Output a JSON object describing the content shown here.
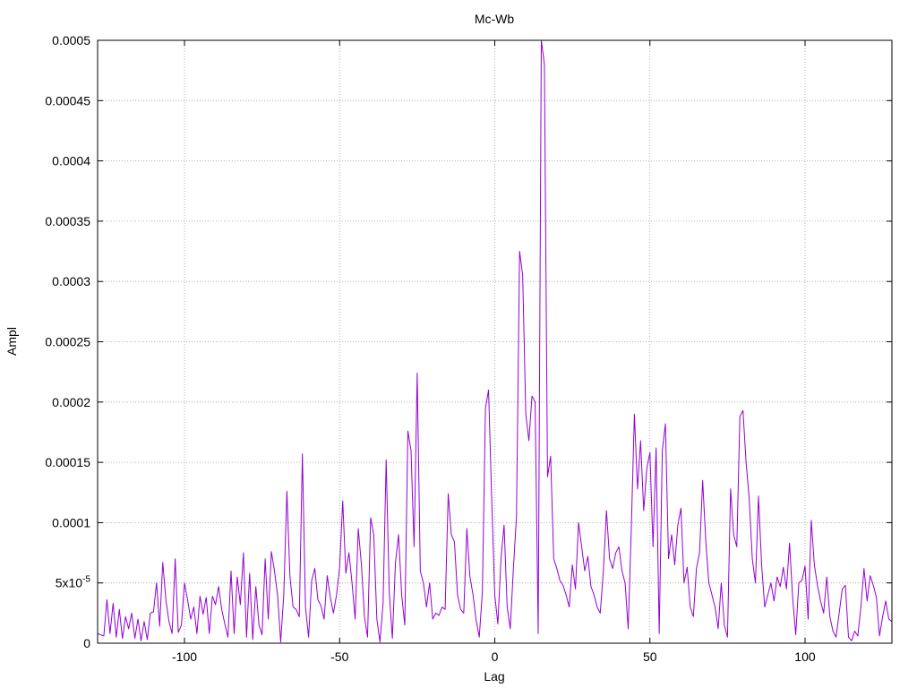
{
  "chart_data": {
    "type": "line",
    "title": "Mc-Wb",
    "xlabel": "Lag",
    "ylabel": "Ampl",
    "xlim": [
      -128,
      128
    ],
    "ylim": [
      0,
      0.0005
    ],
    "grid": true,
    "x_ticks": [
      {
        "value": -100,
        "label": "-100"
      },
      {
        "value": -50,
        "label": "-50"
      },
      {
        "value": 0,
        "label": "0"
      },
      {
        "value": 50,
        "label": "50"
      },
      {
        "value": 100,
        "label": "100"
      }
    ],
    "y_ticks": [
      {
        "value": 0,
        "label": "0"
      },
      {
        "value": 5e-05,
        "label": "5x10",
        "sup": "-5"
      },
      {
        "value": 0.0001,
        "label": "0.0001"
      },
      {
        "value": 0.00015,
        "label": "0.00015"
      },
      {
        "value": 0.0002,
        "label": "0.0002"
      },
      {
        "value": 0.00025,
        "label": "0.00025"
      },
      {
        "value": 0.0003,
        "label": "0.0003"
      },
      {
        "value": 0.00035,
        "label": "0.00035"
      },
      {
        "value": 0.0004,
        "label": "0.0004"
      },
      {
        "value": 0.00045,
        "label": "0.00045"
      },
      {
        "value": 0.0005,
        "label": "0.0005"
      }
    ],
    "series": [
      {
        "color": "#9400d3",
        "points": [
          [
            -128,
            8e-06
          ],
          [
            -126,
            6e-06
          ],
          [
            -125,
            3.6e-05
          ],
          [
            -124,
            8e-06
          ],
          [
            -123,
            3.3e-05
          ],
          [
            -122,
            5e-06
          ],
          [
            -121,
            2.8e-05
          ],
          [
            -120,
            4e-06
          ],
          [
            -119,
            2.2e-05
          ],
          [
            -118,
            1.2e-05
          ],
          [
            -117,
            2.5e-05
          ],
          [
            -116,
            4e-06
          ],
          [
            -115,
            2e-05
          ],
          [
            -114,
            2e-06
          ],
          [
            -113,
            1.8e-05
          ],
          [
            -112,
            3e-06
          ],
          [
            -111,
            2.5e-05
          ],
          [
            -110,
            2.6e-05
          ],
          [
            -109,
            5e-05
          ],
          [
            -108,
            1.4e-05
          ],
          [
            -107,
            6.7e-05
          ],
          [
            -106,
            3.6e-05
          ],
          [
            -105,
            1.8e-05
          ],
          [
            -104,
            8e-06
          ],
          [
            -103,
            7e-05
          ],
          [
            -102,
            9e-06
          ],
          [
            -101,
            1.5e-05
          ],
          [
            -100,
            5e-05
          ],
          [
            -99,
            3.6e-05
          ],
          [
            -98,
            2e-05
          ],
          [
            -97,
            3e-05
          ],
          [
            -96,
            8e-06
          ],
          [
            -95,
            3.9e-05
          ],
          [
            -94,
            2.4e-05
          ],
          [
            -93,
            3.8e-05
          ],
          [
            -92,
            8e-06
          ],
          [
            -91,
            3.9e-05
          ],
          [
            -90,
            3.2e-05
          ],
          [
            -89,
            4.7e-05
          ],
          [
            -88,
            2.8e-05
          ],
          [
            -87,
            1.6e-05
          ],
          [
            -86,
            5e-06
          ],
          [
            -85,
            6e-05
          ],
          [
            -84,
            8e-06
          ],
          [
            -83,
            5.5e-05
          ],
          [
            -82,
            3.2e-05
          ],
          [
            -81,
            7.5e-05
          ],
          [
            -80,
            5e-06
          ],
          [
            -79,
            5.8e-05
          ],
          [
            -78,
            3e-06
          ],
          [
            -77,
            4.7e-05
          ],
          [
            -76,
            1.5e-05
          ],
          [
            -75,
            7e-06
          ],
          [
            -74,
            7e-05
          ],
          [
            -73,
            2e-05
          ],
          [
            -72,
            7.6e-05
          ],
          [
            -71,
            6e-05
          ],
          [
            -70,
            4e-05
          ],
          [
            -69,
            1e-06
          ],
          [
            -68,
            4e-05
          ],
          [
            -67,
            0.000126
          ],
          [
            -66,
            5.5e-05
          ],
          [
            -65,
            3e-05
          ],
          [
            -64,
            2.8e-05
          ],
          [
            -63,
            2.2e-05
          ],
          [
            -62,
            0.000157
          ],
          [
            -61,
            3e-05
          ],
          [
            -60,
            5e-06
          ],
          [
            -59,
            5.2e-05
          ],
          [
            -58,
            6.2e-05
          ],
          [
            -57,
            3.6e-05
          ],
          [
            -56,
            3.1e-05
          ],
          [
            -55,
            2e-05
          ],
          [
            -54,
            5.6e-05
          ],
          [
            -53,
            3.8e-05
          ],
          [
            -52,
            2.5e-05
          ],
          [
            -51,
            4e-05
          ],
          [
            -50,
            6.3e-05
          ],
          [
            -49,
            0.000118
          ],
          [
            -48,
            5.8e-05
          ],
          [
            -47,
            7.5e-05
          ],
          [
            -46,
            5e-05
          ],
          [
            -45,
            2e-05
          ],
          [
            -44,
            9.5e-05
          ],
          [
            -43,
            6.6e-05
          ],
          [
            -42,
            2.2e-05
          ],
          [
            -41,
            5e-06
          ],
          [
            -40,
            0.000104
          ],
          [
            -39,
            9e-05
          ],
          [
            -38,
            2e-05
          ],
          [
            -37,
            1e-06
          ],
          [
            -36,
            3.3e-05
          ],
          [
            -35,
            0.000152
          ],
          [
            -34,
            4.2e-05
          ],
          [
            -33,
            4e-06
          ],
          [
            -32,
            6.7e-05
          ],
          [
            -31,
            9e-05
          ],
          [
            -30,
            4e-05
          ],
          [
            -29,
            1.5e-05
          ],
          [
            -28,
            0.000176
          ],
          [
            -27,
            0.00016
          ],
          [
            -26,
            8e-05
          ],
          [
            -25,
            0.000224
          ],
          [
            -24,
            6e-05
          ],
          [
            -23,
            5e-05
          ],
          [
            -22,
            3e-05
          ],
          [
            -21,
            5e-05
          ],
          [
            -20,
            2e-05
          ],
          [
            -19,
            2.5e-05
          ],
          [
            -18,
            2.3e-05
          ],
          [
            -17,
            3e-05
          ],
          [
            -16,
            2.8e-05
          ],
          [
            -15,
            0.000124
          ],
          [
            -14,
            9e-05
          ],
          [
            -13,
            8.4e-05
          ],
          [
            -12,
            4e-05
          ],
          [
            -11,
            2.8e-05
          ],
          [
            -10,
            2.5e-05
          ],
          [
            -9,
            9.5e-05
          ],
          [
            -8,
            5.5e-05
          ],
          [
            -7,
            4e-05
          ],
          [
            -6,
            1.9e-05
          ],
          [
            -5,
            5e-06
          ],
          [
            -4,
            4.2e-05
          ],
          [
            -3,
            0.000195
          ],
          [
            -2,
            0.00021
          ],
          [
            -1,
            0.00012
          ],
          [
            0,
            4e-05
          ],
          [
            1,
            1.6e-05
          ],
          [
            2,
            7e-05
          ],
          [
            3,
            9.8e-05
          ],
          [
            4,
            3e-05
          ],
          [
            5,
            1.2e-05
          ],
          [
            6,
            6.2e-05
          ],
          [
            7,
            0.000105
          ],
          [
            8,
            0.000325
          ],
          [
            9,
            0.000305
          ],
          [
            10,
            0.00019
          ],
          [
            11,
            0.000168
          ],
          [
            12,
            0.000205
          ],
          [
            13,
            0.0002
          ],
          [
            14,
            8e-06
          ],
          [
            15,
            0.0005
          ],
          [
            16,
            0.00048
          ],
          [
            17,
            0.000138
          ],
          [
            18,
            0.000155
          ],
          [
            19,
            7e-05
          ],
          [
            20,
            6.2e-05
          ],
          [
            21,
            5.2e-05
          ],
          [
            22,
            4.8e-05
          ],
          [
            23,
            4e-05
          ],
          [
            24,
            3e-05
          ],
          [
            25,
            6.5e-05
          ],
          [
            26,
            4.5e-05
          ],
          [
            27,
            0.0001
          ],
          [
            28,
            8e-05
          ],
          [
            29,
            6e-05
          ],
          [
            30,
            7.2e-05
          ],
          [
            31,
            4.7e-05
          ],
          [
            32,
            4e-05
          ],
          [
            33,
            3e-05
          ],
          [
            34,
            2.5e-05
          ],
          [
            35,
            6e-05
          ],
          [
            36,
            0.00011
          ],
          [
            37,
            7e-05
          ],
          [
            38,
            6.2e-05
          ],
          [
            39,
            7.5e-05
          ],
          [
            40,
            8e-05
          ],
          [
            41,
            6e-05
          ],
          [
            42,
            5e-05
          ],
          [
            43,
            1.2e-05
          ],
          [
            44,
            9.5e-05
          ],
          [
            45,
            0.00019
          ],
          [
            46,
            0.000128
          ],
          [
            47,
            0.000168
          ],
          [
            48,
            0.00011
          ],
          [
            49,
            0.000145
          ],
          [
            50,
            0.000158
          ],
          [
            51,
            8e-05
          ],
          [
            52,
            0.000162
          ],
          [
            53,
            8e-06
          ],
          [
            54,
            0.00016
          ],
          [
            55,
            0.000182
          ],
          [
            56,
            7e-05
          ],
          [
            57,
            9e-05
          ],
          [
            58,
            6.5e-05
          ],
          [
            59,
            9.8e-05
          ],
          [
            60,
            0.000112
          ],
          [
            61,
            5e-05
          ],
          [
            62,
            6.3e-05
          ],
          [
            63,
            3e-05
          ],
          [
            64,
            2.2e-05
          ],
          [
            65,
            6.2e-05
          ],
          [
            66,
            7.5e-05
          ],
          [
            67,
            0.000135
          ],
          [
            68,
            8.5e-05
          ],
          [
            69,
            5e-05
          ],
          [
            70,
            4e-05
          ],
          [
            71,
            3e-05
          ],
          [
            72,
            1.2e-05
          ],
          [
            73,
            5e-05
          ],
          [
            74,
            1.5e-05
          ],
          [
            75,
            5e-06
          ],
          [
            76,
            0.000128
          ],
          [
            77,
            9e-05
          ],
          [
            78,
            8e-05
          ],
          [
            79,
            0.000188
          ],
          [
            80,
            0.000193
          ],
          [
            81,
            0.00015
          ],
          [
            82,
            0.00012
          ],
          [
            83,
            7e-05
          ],
          [
            84,
            5e-05
          ],
          [
            85,
            0.000122
          ],
          [
            86,
            6.5e-05
          ],
          [
            87,
            3e-05
          ],
          [
            88,
            4e-05
          ],
          [
            89,
            5e-05
          ],
          [
            90,
            3.5e-05
          ],
          [
            91,
            5.5e-05
          ],
          [
            92,
            4.7e-05
          ],
          [
            93,
            6.3e-05
          ],
          [
            94,
            4.5e-05
          ],
          [
            95,
            8.3e-05
          ],
          [
            96,
            3.8e-05
          ],
          [
            97,
            7e-06
          ],
          [
            98,
            5e-05
          ],
          [
            99,
            5.2e-05
          ],
          [
            100,
            6.4e-05
          ],
          [
            101,
            2e-05
          ],
          [
            102,
            0.000102
          ],
          [
            103,
            6.5e-05
          ],
          [
            104,
            4.8e-05
          ],
          [
            105,
            3.5e-05
          ],
          [
            106,
            2.5e-05
          ],
          [
            107,
            5.5e-05
          ],
          [
            108,
            2.2e-05
          ],
          [
            109,
            1e-05
          ],
          [
            110,
            5e-06
          ],
          [
            111,
            2.5e-05
          ],
          [
            112,
            4.5e-05
          ],
          [
            113,
            4.8e-05
          ],
          [
            114,
            5e-06
          ],
          [
            115,
            2e-06
          ],
          [
            116,
            1e-05
          ],
          [
            117,
            6e-06
          ],
          [
            118,
            3e-05
          ],
          [
            119,
            6.2e-05
          ],
          [
            120,
            3.5e-05
          ],
          [
            121,
            5.6e-05
          ],
          [
            122,
            4.8e-05
          ],
          [
            123,
            3.8e-05
          ],
          [
            124,
            6e-06
          ],
          [
            125,
            2.2e-05
          ],
          [
            126,
            3.5e-05
          ],
          [
            127,
            2e-05
          ],
          [
            128,
            1.8e-05
          ]
        ]
      }
    ]
  }
}
